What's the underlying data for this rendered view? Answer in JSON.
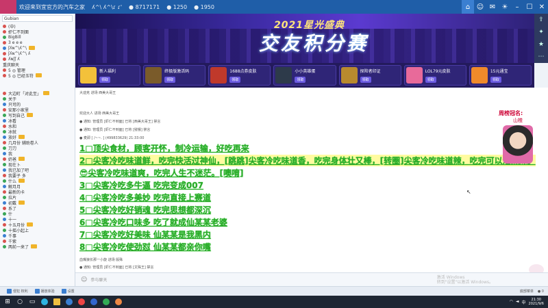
{
  "titlebar": {
    "items": [
      "欢迎来到宜官方的汽车之家",
      "ʎ^\\ ʎ^\\ɾ ɾ'",
      "● 8717171",
      "● 1250",
      "● 1950"
    ],
    "buttons": [
      "home-icon",
      "user-icon",
      "chat-icon",
      "bell-icon",
      "minimize-icon",
      "maximize-icon",
      "close-icon"
    ]
  },
  "sidebar": {
    "search_text": "Gubian",
    "top_rows": [
      "(中)",
      "虾仁不到面",
      "BigBill",
      "3 e e e",
      "ʃʎɴ^\\ʎ^\\",
      "ʃʎɴ^\\ʎ^\\ ʎ",
      "ʎɴʃʃ ʎ"
    ],
    "group_label": "重庆聊天",
    "group_rows": [
      "5 ◎ 管理",
      "5 ◎ 已经玉符"
    ],
    "rows": [
      "大边町「对此至」",
      "关于",
      "只可的",
      "安那小家里",
      "写到自己",
      "冰看",
      "水和",
      "冰就",
      "放好",
      "几月份 辅助卷人",
      "刀刀",
      "我",
      "奶爸",
      "现在卜",
      "我已加了吧",
      "我要子 多",
      "什么",
      "解月月",
      "最新的卡",
      "拉片",
      "初戴",
      "系了",
      "什",
      "十一",
      "十五月份",
      "十摇小起上",
      "千事",
      "千紫",
      "两前一来了"
    ]
  },
  "banner": {
    "year": "2021星光盛典",
    "title": "交友积分赛"
  },
  "gifts": [
    {
      "name": "新人福利",
      "label": "新人福利",
      "btn": "领取"
    },
    {
      "name": "终极版激活码",
      "label": "终极版激活码",
      "btn": "领取"
    },
    {
      "name": "1688点券皮肤",
      "label": "1688点券皮肤",
      "btn": "领取"
    },
    {
      "name": "小小英雄蛋",
      "label": "小小英雄蛋",
      "btn": "领取"
    },
    {
      "name": "探险者印证",
      "label": "探险者印证",
      "btn": "领取"
    },
    {
      "name": "LOL79元皮肤",
      "label": "LOL79元皮肤",
      "btn": "领取"
    },
    {
      "name": "15元通宝",
      "label": "15元通宝",
      "btn": "领取"
    }
  ],
  "chat": {
    "system_lines": [
      "大迪克 进场 西美大哥王",
      "欢迎大人 进场 西美大哥王",
      "● 通知: 管理员 [虾仁不到面] 已将 [西美大哥王] 禁言",
      "● 通知: 管理员 [虾仁不到面] 已将 [猕猴] 禁言",
      "● 麦即 [ /~~. ] (499833629) 21:33:00"
    ],
    "messages": [
      "1□顶尖食材，顾客开怀，制冷运输，好吃再来",
      "2□尖客冷吃味道鲜，吃完快活过神仙，[跳跳]尖客冷吃味道香，吃完身体壮又棒，[转圈]尖客冷吃味道辣，吃完可以泡辣妹。",
      "😎尖客冷吃味道爽，吃完人生不迷茫。[噢唷]",
      "3□尖客冷吃多牛逼 吃完变成007",
      "4□尖客冷吃多美妙 吃完直接上赛道",
      "5□尖客冷吃好销魂 吃完思想都深沉",
      "6□尖客冷吃口味多 吃了就成仙某某老婆",
      "7□尖客冷吃好美味 仙某某是我黑内",
      "8□尖客冷吃使劲怼 仙某某都亲你嘴"
    ],
    "bottom_lines": [
      "血嘴狼长那一小旋 进场 骰殊",
      "● 通知: 管理员 [虾仁不到面] 已将 [文殊王] 禁言"
    ],
    "rank_head": "周榜冠名:",
    "rank_name": "山楂"
  },
  "input": {
    "placeholder": "参与聊天",
    "watermark_line1": "激活 Windows",
    "watermark_line2": "转到\"设置\"以激活 Windows。"
  },
  "bottombar": {
    "items": [
      "侵犯 权利",
      "播放体验",
      "设置"
    ],
    "right": [
      "底部菜单",
      "● 0"
    ]
  },
  "taskbar": {
    "time": "21:30",
    "date": "2021/9/6"
  }
}
